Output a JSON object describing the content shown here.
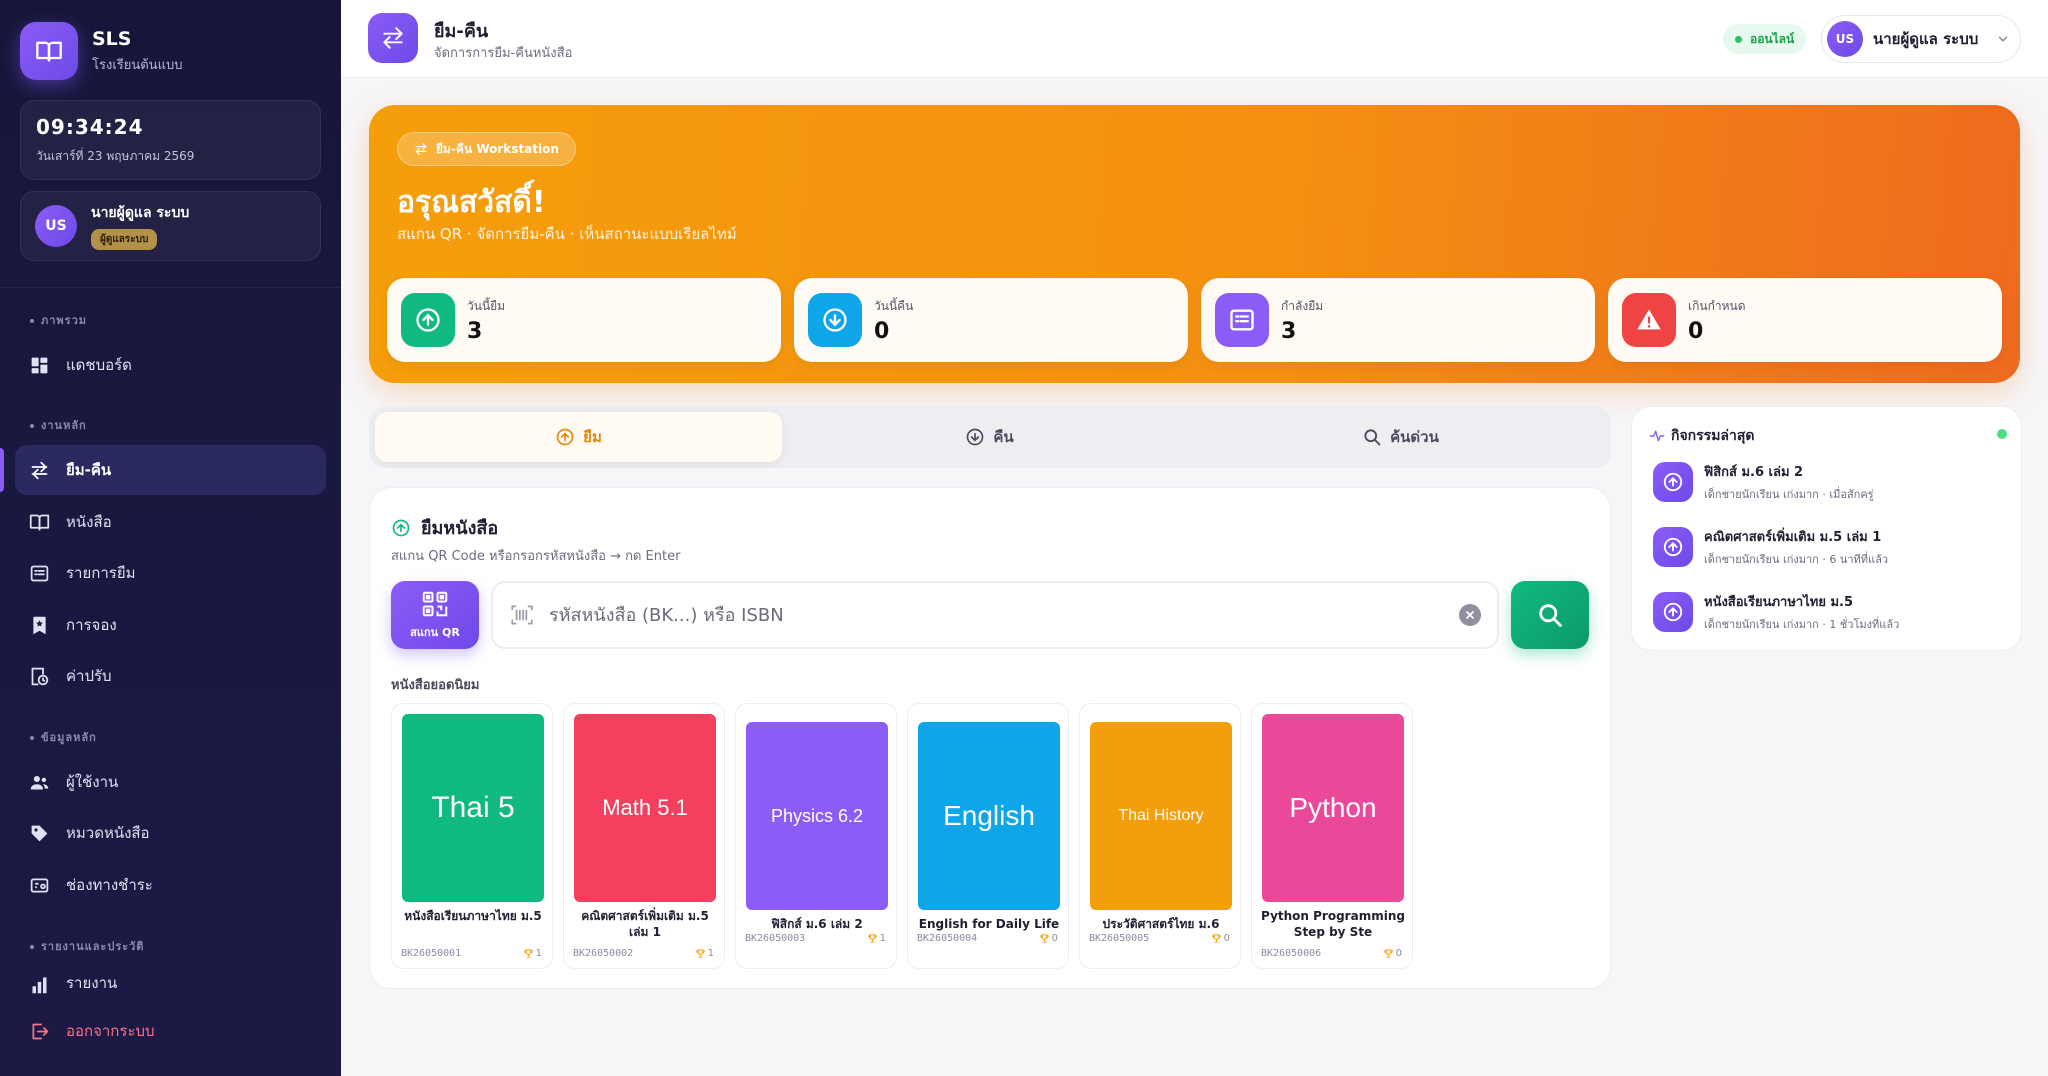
{
  "sidebar": {
    "brand_name": "SLS",
    "brand_sub": "โรงเรียนต้นแบบ",
    "clock_time": "09:34:24",
    "clock_date": "วันเสาร์ที่ 23 พฤษภาคม 2569",
    "user_initials": "US",
    "user_name": "นายผู้ดูแล ระบบ",
    "user_role": "ผู้ดูแลระบบ",
    "sections": {
      "overview": "ภาพรวม",
      "main": "งานหลัก",
      "master": "ข้อมูลหลัก",
      "reports": "รายงานและประวัติ"
    },
    "items": {
      "dashboard": "แดชบอร์ด",
      "borrow_return": "ยืม-คืน",
      "books": "หนังสือ",
      "loans": "รายการยืม",
      "reservations": "การจอง",
      "fines": "ค่าปรับ",
      "users": "ผู้ใช้งาน",
      "categories": "หมวดหนังสือ",
      "payment": "ช่องทางชำระ",
      "report": "รายงาน",
      "logout": "ออกจากระบบ"
    }
  },
  "header": {
    "title": "ยืม-คืน",
    "subtitle": "จัดการการยืม-คืนหนังสือ",
    "status": "ออนไลน์",
    "user_initials": "US",
    "user_name": "นายผู้ดูแล ระบบ"
  },
  "hero": {
    "chip": "ยืม-คืน Workstation",
    "title": "อรุณสวัสดิ์!",
    "subtitle": "สแกน QR · จัดการยืม-คืน · เห็นสถานะแบบเรียลไทม์",
    "stats": [
      {
        "label": "วันนี้ยืม",
        "value": "3",
        "color": "#10b981"
      },
      {
        "label": "วันนี้คืน",
        "value": "0",
        "color": "#0ea5e9"
      },
      {
        "label": "กำลังยืม",
        "value": "3",
        "color": "#8b5cf6"
      },
      {
        "label": "เกินกำหนด",
        "value": "0",
        "color": "#ef4444"
      }
    ]
  },
  "tabs": {
    "borrow": "ยืม",
    "return": "คืน",
    "quick_search": "ค้นด่วน"
  },
  "borrow_panel": {
    "title": "ยืมหนังสือ",
    "subtitle": "สแกน QR Code หรือกรอกรหัสหนังสือ → กด Enter",
    "scan_label": "สแกน QR",
    "search_placeholder": "รหัสหนังสือ (BK...) หรือ ISBN",
    "popular_title": "หนังสือยอดนิยม",
    "books": [
      {
        "cover": "Thai 5",
        "name": "หนังสือเรียนภาษาไทย ม.5",
        "code": "BK26050001",
        "count": "1",
        "color": "#10b981"
      },
      {
        "cover": "Math 5.1",
        "name": "คณิตศาสตร์เพิ่มเติม ม.5 เล่ม 1",
        "code": "BK26050002",
        "count": "1",
        "color": "#f43f5e"
      },
      {
        "cover": "Physics 6.2",
        "name": "ฟิสิกส์ ม.6 เล่ม 2",
        "code": "BK26050003",
        "count": "1",
        "color": "#8b5cf6"
      },
      {
        "cover": "English",
        "name": "English for Daily Life",
        "code": "BK26050004",
        "count": "0",
        "color": "#0ea5e9"
      },
      {
        "cover": "Thai History",
        "name": "ประวัติศาสตร์ไทย ม.6",
        "code": "BK26050005",
        "count": "0",
        "color": "#f59e0b"
      },
      {
        "cover": "Python",
        "name": "Python Programming Step by Ste",
        "code": "BK26050006",
        "count": "0",
        "color": "#ec4899"
      }
    ]
  },
  "activity": {
    "title": "กิจกรรมล่าสุด",
    "items": [
      {
        "name": "ฟิสิกส์ ม.6 เล่ม 2",
        "meta": "เด็กชายนักเรียน เก่งมาก · เมื่อสักครู่"
      },
      {
        "name": "คณิตศาสตร์เพิ่มเติม ม.5 เล่ม 1",
        "meta": "เด็กชายนักเรียน เก่งมาก · 6 นาทีที่แล้ว"
      },
      {
        "name": "หนังสือเรียนภาษาไทย ม.5",
        "meta": "เด็กชายนักเรียน เก่งมาก · 1 ชั่วโมงที่แล้ว"
      }
    ]
  }
}
